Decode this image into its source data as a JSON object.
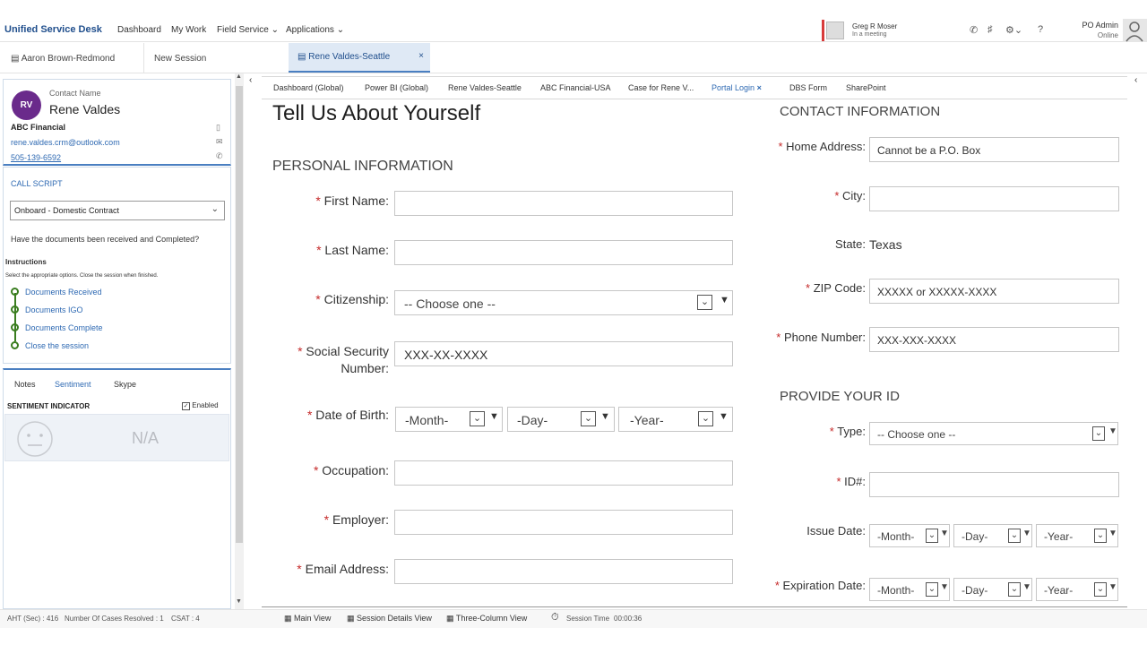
{
  "topnav": {
    "brand": "Unified Service Desk",
    "items": [
      "Dashboard",
      "My Work",
      "Field Service",
      "Applications"
    ],
    "user_name": "Greg R Moser",
    "user_status": "In a meeting",
    "admin_name": "PO Admin",
    "admin_status": "Online"
  },
  "sessions": {
    "items": [
      "Aaron Brown-Redmond",
      "New Session"
    ],
    "active": "Rene Valdes-Seattle"
  },
  "contact": {
    "initials": "RV",
    "label": "Contact Name",
    "name": "Rene Valdes",
    "company": "ABC Financial",
    "email": "rene.valdes.crm@outlook.com",
    "phone": "505-139-6592"
  },
  "call_script": {
    "title": "CALL SCRIPT",
    "selected": "Onboard - Domestic Contract",
    "question": "Have the documents been received and Completed?",
    "instructions_title": "Instructions",
    "instructions": "Select the appropriate options. Close the session when finished.",
    "steps": [
      "Documents Received",
      "Documents IGO",
      "Documents Complete",
      "Close the session"
    ]
  },
  "lower_tabs": {
    "tabs": [
      "Notes",
      "Sentiment",
      "Skype"
    ],
    "indicator_title": "SENTIMENT INDICATOR",
    "enabled_label": "Enabled",
    "value": "N/A"
  },
  "apptabs": [
    "Dashboard (Global)",
    "Power BI (Global)",
    "Rene Valdes-Seattle",
    "ABC Financial-USA",
    "Case for Rene V...",
    "Portal Login",
    "DBS Form",
    "SharePoint"
  ],
  "form": {
    "title": "Tell Us About Yourself",
    "personal_section": "PERSONAL INFORMATION",
    "first_name": "First Name:",
    "last_name": "Last Name:",
    "citizenship": "Citizenship:",
    "citizenship_value": "-- Choose one --",
    "ssn_line1": "Social Security",
    "ssn_line2": "Number:",
    "ssn_placeholder": "XXX-XX-XXXX",
    "dob": "Date of Birth:",
    "month": "-Month-",
    "day": "-Day-",
    "year": "-Year-",
    "occupation": "Occupation:",
    "employer": "Employer:",
    "email": "Email Address:",
    "contact_section": "CONTACT INFORMATION",
    "home_address": "Home Address:",
    "home_placeholder": "Cannot be a P.O. Box",
    "city": "City:",
    "state_label": "State:",
    "state_value": "Texas",
    "zip": "ZIP Code:",
    "zip_placeholder": "XXXXX or XXXXX-XXXX",
    "phone": "Phone Number:",
    "phone_placeholder": "XXX-XXX-XXXX",
    "id_section": "PROVIDE YOUR ID",
    "type": "Type:",
    "type_value": "-- Choose one --",
    "id_num": "ID#:",
    "issue_date": "Issue Date:",
    "expiration_date": "Expiration Date:"
  },
  "status": {
    "aht": "AHT (Sec) :  416",
    "cases": "Number Of Cases Resolved :  1",
    "csat": "CSAT :  4",
    "main_view": "Main View",
    "session_details": "Session Details View",
    "three_col": "Three-Column View",
    "session_time_label": "Session Time",
    "session_time": "00:00:36"
  }
}
